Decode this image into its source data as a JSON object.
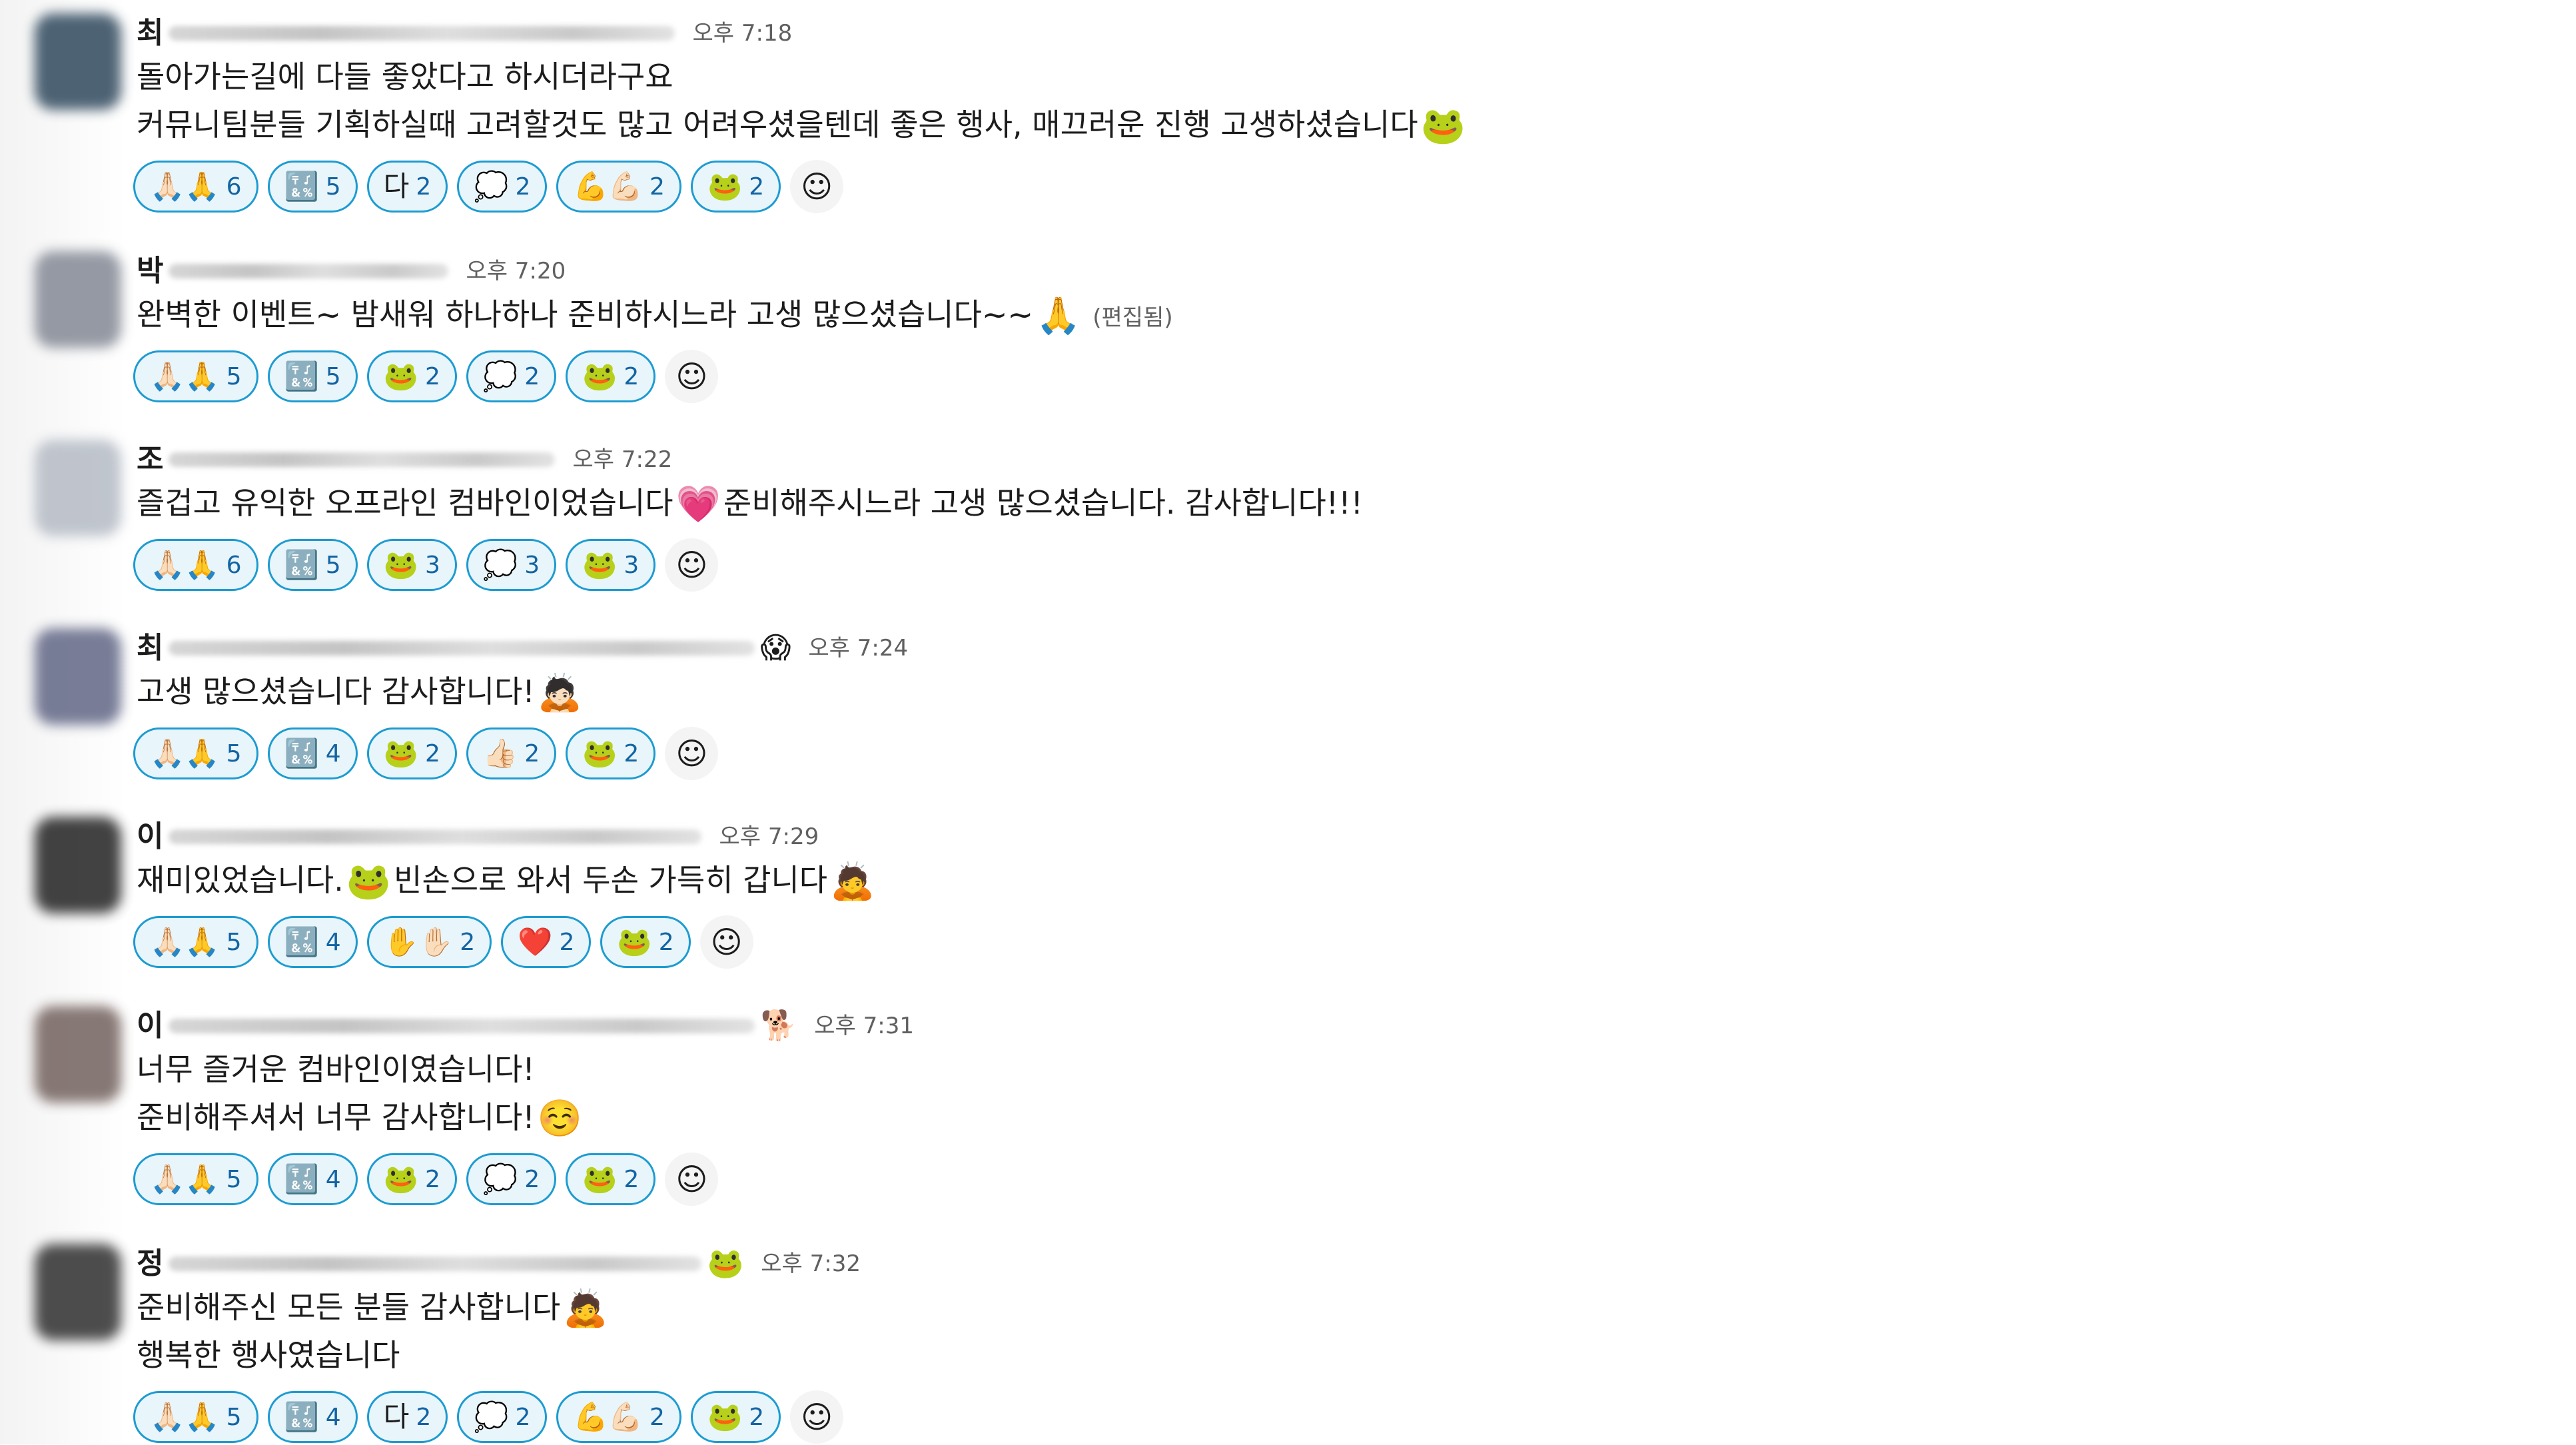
{
  "messages": [
    {
      "author": "최",
      "time": "오후 7:18",
      "status_emoji": "",
      "avatar_color": "#3b5366",
      "lines": [
        {
          "text": "돌아가는길에 다들 좋았다고 하시더라구요",
          "emoji": ""
        },
        {
          "text": "커뮤니팀분들 기획하실때 고려할것도 많고 어려우셨을텐데 좋은 행사, 매끄러운 진행 고생하셨습니다",
          "emoji": "🐸"
        }
      ],
      "edited": "",
      "reactions": [
        {
          "emoji": "🙏🏻🙏",
          "count": "6"
        },
        {
          "emoji": "🔣",
          "count": "5"
        },
        {
          "emoji": "다",
          "count": "2"
        },
        {
          "emoji": "💭",
          "count": "2"
        },
        {
          "emoji": "💪💪🏻",
          "count": "2"
        },
        {
          "emoji": "🐸",
          "count": "2"
        }
      ]
    },
    {
      "author": "박",
      "time": "오후 7:20",
      "status_emoji": "",
      "avatar_color": "#8a8f9a",
      "lines": [
        {
          "text": "완벽한 이벤트~ 밤새워 하나하나 준비하시느라 고생 많으셨습니다~~",
          "emoji": "🙏"
        }
      ],
      "edited": "(편집됨)",
      "reactions": [
        {
          "emoji": "🙏🏻🙏",
          "count": "5"
        },
        {
          "emoji": "🔣",
          "count": "5"
        },
        {
          "emoji": "🐸",
          "count": "2"
        },
        {
          "emoji": "💭",
          "count": "2"
        },
        {
          "emoji": "🐸",
          "count": "2"
        }
      ]
    },
    {
      "author": "조",
      "time": "오후 7:22",
      "status_emoji": "",
      "avatar_color": "#b9bfc8",
      "lines": [
        {
          "text": "즐겁고 유익한 오프라인 컴바인이었습니다",
          "emoji": "💗",
          "after": "준비해주시느라 고생 많으셨습니다. 감사합니다!!!"
        }
      ],
      "edited": "",
      "reactions": [
        {
          "emoji": "🙏🏻🙏",
          "count": "6"
        },
        {
          "emoji": "🔣",
          "count": "5"
        },
        {
          "emoji": "🐸",
          "count": "3"
        },
        {
          "emoji": "💭",
          "count": "3"
        },
        {
          "emoji": "🐸",
          "count": "3"
        }
      ]
    },
    {
      "author": "최",
      "time": "오후 7:24",
      "status_emoji": "😱",
      "avatar_color": "#6a6f8c",
      "lines": [
        {
          "text": "고생 많으셨습니다 감사합니다!",
          "emoji": "🙇🏻"
        }
      ],
      "edited": "",
      "reactions": [
        {
          "emoji": "🙏🏻🙏",
          "count": "5"
        },
        {
          "emoji": "🔣",
          "count": "4"
        },
        {
          "emoji": "🐸",
          "count": "2"
        },
        {
          "emoji": "👍🏻",
          "count": "2"
        },
        {
          "emoji": "🐸",
          "count": "2"
        }
      ]
    },
    {
      "author": "이",
      "time": "오후 7:29",
      "status_emoji": "",
      "avatar_color": "#2e2e2e",
      "lines": [
        {
          "text": "재미있었습니다.",
          "emoji": "🐸",
          "after": "빈손으로 와서 두손 가득히 갑니다",
          "emoji2": "🙇"
        }
      ],
      "edited": "",
      "reactions": [
        {
          "emoji": "🙏🏻🙏",
          "count": "5"
        },
        {
          "emoji": "🔣",
          "count": "4"
        },
        {
          "emoji": "✋✋🏻",
          "count": "2"
        },
        {
          "emoji": "❤️",
          "count": "2"
        },
        {
          "emoji": "🐸",
          "count": "2"
        }
      ]
    },
    {
      "author": "이",
      "time": "오후 7:31",
      "status_emoji": "🐕",
      "avatar_color": "#7a6a66",
      "lines": [
        {
          "text": "너무 즐거운 컴바인이였습니다!",
          "emoji": ""
        },
        {
          "text": "준비해주셔서 너무 감사합니다!",
          "emoji": "☺️"
        }
      ],
      "edited": "",
      "reactions": [
        {
          "emoji": "🙏🏻🙏",
          "count": "5"
        },
        {
          "emoji": "🔣",
          "count": "4"
        },
        {
          "emoji": "🐸",
          "count": "2"
        },
        {
          "emoji": "💭",
          "count": "2"
        },
        {
          "emoji": "🐸",
          "count": "2"
        }
      ]
    },
    {
      "author": "정",
      "time": "오후 7:32",
      "status_emoji": "🐸",
      "avatar_color": "#3a3a3a",
      "lines": [
        {
          "text": "준비해주신 모든 분들 감사합니다",
          "emoji": "🙇"
        },
        {
          "text": "행복한 행사였습니다",
          "emoji": ""
        }
      ],
      "edited": "",
      "reactions": [
        {
          "emoji": "🙏🏻🙏",
          "count": "5"
        },
        {
          "emoji": "🔣",
          "count": "4"
        },
        {
          "emoji": "다",
          "count": "2"
        },
        {
          "emoji": "💭",
          "count": "2"
        },
        {
          "emoji": "💪💪🏻",
          "count": "2"
        },
        {
          "emoji": "🐸",
          "count": "2"
        }
      ]
    }
  ],
  "add_reaction_icon": "add-reaction-icon"
}
